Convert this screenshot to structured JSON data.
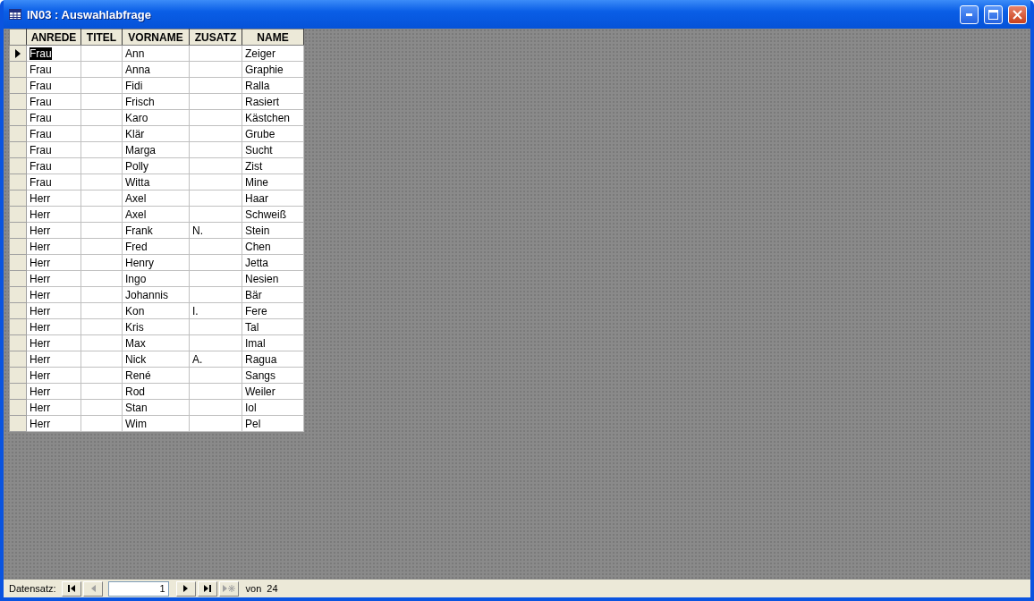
{
  "window": {
    "title": "IN03 : Auswahlabfrage"
  },
  "table": {
    "columns": [
      "ANREDE",
      "TITEL",
      "VORNAME",
      "ZUSATZ",
      "NAME"
    ],
    "rows": [
      {
        "selected": true,
        "cells": [
          "Frau",
          "",
          "Ann",
          "",
          "Zeiger"
        ]
      },
      {
        "selected": false,
        "cells": [
          "Frau",
          "",
          "Anna",
          "",
          "Graphie"
        ]
      },
      {
        "selected": false,
        "cells": [
          "Frau",
          "",
          "Fidi",
          "",
          "Ralla"
        ]
      },
      {
        "selected": false,
        "cells": [
          "Frau",
          "",
          "Frisch",
          "",
          "Rasiert"
        ]
      },
      {
        "selected": false,
        "cells": [
          "Frau",
          "",
          "Karo",
          "",
          "Kästchen"
        ]
      },
      {
        "selected": false,
        "cells": [
          "Frau",
          "",
          "Klär",
          "",
          "Grube"
        ]
      },
      {
        "selected": false,
        "cells": [
          "Frau",
          "",
          "Marga",
          "",
          "Sucht"
        ]
      },
      {
        "selected": false,
        "cells": [
          "Frau",
          "",
          "Polly",
          "",
          "Zist"
        ]
      },
      {
        "selected": false,
        "cells": [
          "Frau",
          "",
          "Witta",
          "",
          "Mine"
        ]
      },
      {
        "selected": false,
        "cells": [
          "Herr",
          "",
          "Axel",
          "",
          "Haar"
        ]
      },
      {
        "selected": false,
        "cells": [
          "Herr",
          "",
          "Axel",
          "",
          "Schweiß"
        ]
      },
      {
        "selected": false,
        "cells": [
          "Herr",
          "",
          "Frank",
          "N.",
          "Stein"
        ]
      },
      {
        "selected": false,
        "cells": [
          "Herr",
          "",
          "Fred",
          "",
          "Chen"
        ]
      },
      {
        "selected": false,
        "cells": [
          "Herr",
          "",
          "Henry",
          "",
          "Jetta"
        ]
      },
      {
        "selected": false,
        "cells": [
          "Herr",
          "",
          "Ingo",
          "",
          "Nesien"
        ]
      },
      {
        "selected": false,
        "cells": [
          "Herr",
          "",
          "Johannis",
          "",
          "Bär"
        ]
      },
      {
        "selected": false,
        "cells": [
          "Herr",
          "",
          "Kon",
          "I.",
          "Fere"
        ]
      },
      {
        "selected": false,
        "cells": [
          "Herr",
          "",
          "Kris",
          "",
          "Tal"
        ]
      },
      {
        "selected": false,
        "cells": [
          "Herr",
          "",
          "Max",
          "",
          "Imal"
        ]
      },
      {
        "selected": false,
        "cells": [
          "Herr",
          "",
          "Nick",
          "A.",
          "Ragua"
        ]
      },
      {
        "selected": false,
        "cells": [
          "Herr",
          "",
          "René",
          "",
          "Sangs"
        ]
      },
      {
        "selected": false,
        "cells": [
          "Herr",
          "",
          "Rod",
          "",
          "Weiler"
        ]
      },
      {
        "selected": false,
        "cells": [
          "Herr",
          "",
          "Stan",
          "",
          "Iol"
        ]
      },
      {
        "selected": false,
        "cells": [
          "Herr",
          "",
          "Wim",
          "",
          "Pel"
        ]
      }
    ]
  },
  "status_bar": {
    "label": "Datensatz:",
    "record": "1",
    "of_label": "von",
    "total": "24",
    "buttons": [
      {
        "kind": "first",
        "disabled": false
      },
      {
        "kind": "prev",
        "disabled": true
      },
      {
        "kind": "field"
      },
      {
        "kind": "next",
        "disabled": false
      },
      {
        "kind": "last",
        "disabled": false
      },
      {
        "kind": "new",
        "disabled": true
      }
    ]
  }
}
